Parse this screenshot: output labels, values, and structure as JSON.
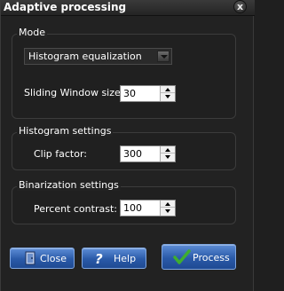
{
  "window": {
    "title": "Adaptive processing",
    "close_glyph": "x"
  },
  "mode": {
    "group_label": "Mode",
    "combo_value": "Histogram equalization",
    "window_size_label": "Sliding Window size:",
    "window_size_value": "30"
  },
  "histogram": {
    "group_label": "Histogram settings",
    "clip_label": "Clip factor:",
    "clip_value": "300"
  },
  "binarization": {
    "group_label": "Binarization settings",
    "percent_label": "Percent contrast:",
    "percent_value": "100"
  },
  "buttons": {
    "close_label": "Close",
    "help_label": "Help",
    "process_label": "Process"
  },
  "colors": {
    "background": "#222222",
    "button_blue": "#2a5aa8",
    "check_green": "#3fae2f"
  }
}
